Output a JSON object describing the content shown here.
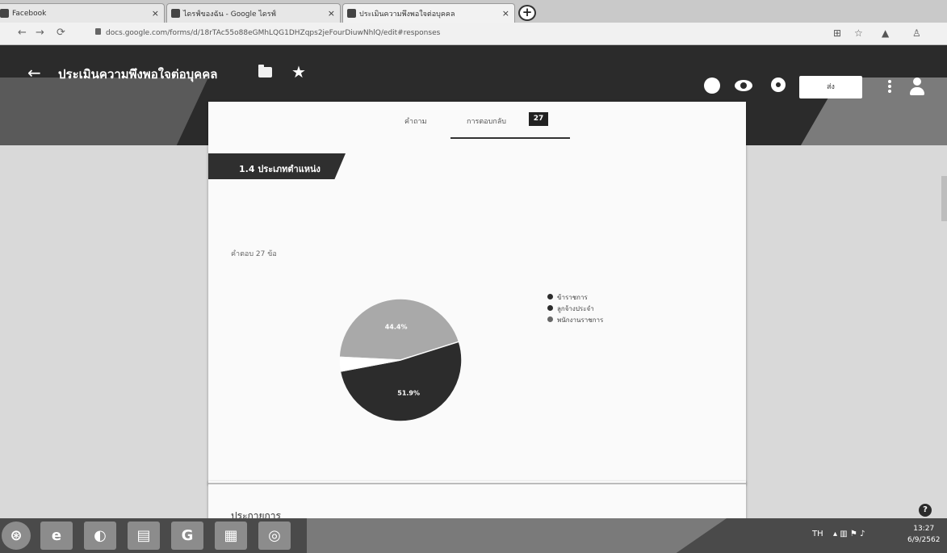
{
  "browser": {
    "tabs": [
      {
        "label": "Facebook"
      },
      {
        "label": "ไดรฟ์ของฉัน - Google ไดรฟ์"
      },
      {
        "label": "ประเมินความพึงพอใจต่อบุคคล"
      }
    ],
    "url": "docs.google.com/forms/d/18rTAc55o88eGMhLQG1DHZqps2jeFourDiuwNhlQ/edit#responses"
  },
  "form": {
    "title": "ประเมินความพึงพอใจต่อบุคคล",
    "send_label": "ส่ง"
  },
  "tabs": {
    "questions_label": "คำถาม",
    "responses_label": "การตอบกลับ",
    "responses_count": "27"
  },
  "question": {
    "title": "1.4 ประเภทตำแหน่ง",
    "response_count_label": "คำตอบ 27 ข้อ"
  },
  "chart_data": {
    "type": "pie",
    "labels": [
      "ข้าราชการ",
      "ลูกจ้างประจำ",
      "พนักงานราชการ"
    ],
    "values": [
      44.4,
      51.9,
      3.7
    ],
    "slice_labels": [
      "44.4%",
      "51.9%",
      ""
    ],
    "colors": [
      "#a9a9a9",
      "#2c2c2c",
      "#ffffff"
    ],
    "legend_position": "right"
  },
  "next_question": {
    "title": "ประกายการ"
  },
  "taskbar": {
    "tray_text": "TH",
    "time": "13:27",
    "date": "6/9/2562"
  }
}
